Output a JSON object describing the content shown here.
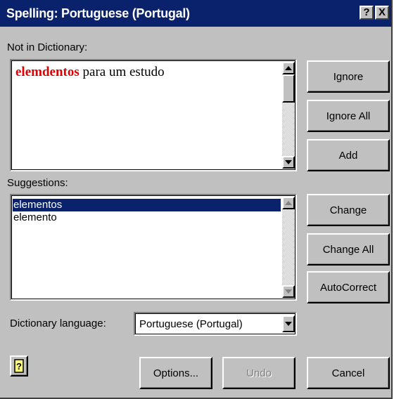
{
  "window": {
    "title": "Spelling: Portuguese (Portugal)",
    "help_glyph": "?",
    "close_glyph": "X"
  },
  "not_in_dictionary": {
    "label": "Not in Dictionary:",
    "misspelled_word": "elemdentos",
    "rest_text": " para um estudo",
    "misspelled_color": "#e00000"
  },
  "suggestions": {
    "label": "Suggestions:",
    "items": [
      "elementos",
      "elemento"
    ],
    "selected_index": 0
  },
  "dictionary_language": {
    "label": "Dictionary language:",
    "value": "Portuguese (Portugal)"
  },
  "buttons": {
    "ignore": "Ignore",
    "ignore_all": "Ignore All",
    "add": "Add",
    "change": "Change",
    "change_all": "Change All",
    "autocorrect": "AutoCorrect",
    "options": "Options...",
    "undo": "Undo",
    "cancel": "Cancel"
  },
  "colors": {
    "titlebar": "#0a216b",
    "face": "#c0c0c0",
    "selection": "#0a216b"
  },
  "icons": {
    "help_button": "office-assistant-icon"
  }
}
